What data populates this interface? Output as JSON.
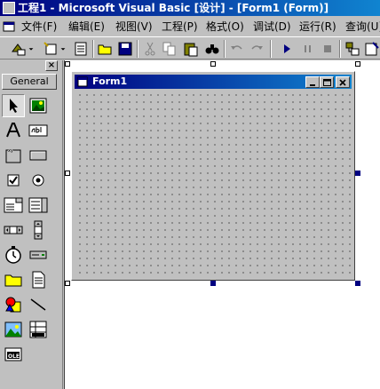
{
  "window": {
    "title": "工程1 - Microsoft Visual Basic [设计] - [Form1 (Form)]"
  },
  "menu": [
    {
      "label": "文件(F)"
    },
    {
      "label": "编辑(E)"
    },
    {
      "label": "视图(V)"
    },
    {
      "label": "工程(P)"
    },
    {
      "label": "格式(O)"
    },
    {
      "label": "调试(D)"
    },
    {
      "label": "运行(R)"
    },
    {
      "label": "查询(U)"
    }
  ],
  "toolbox": {
    "close_label": "×",
    "tab_label": "General",
    "tools": [
      "pointer",
      "picturebox",
      "label",
      "textbox",
      "frame",
      "commandbutton",
      "checkbox",
      "optionbutton",
      "combobox",
      "listbox",
      "hscrollbar",
      "vscrollbar",
      "timer",
      "drivelistbox",
      "dirlistbox",
      "filelistbox",
      "shape",
      "line",
      "image",
      "data",
      "ole"
    ]
  },
  "form": {
    "title": "Form1"
  }
}
